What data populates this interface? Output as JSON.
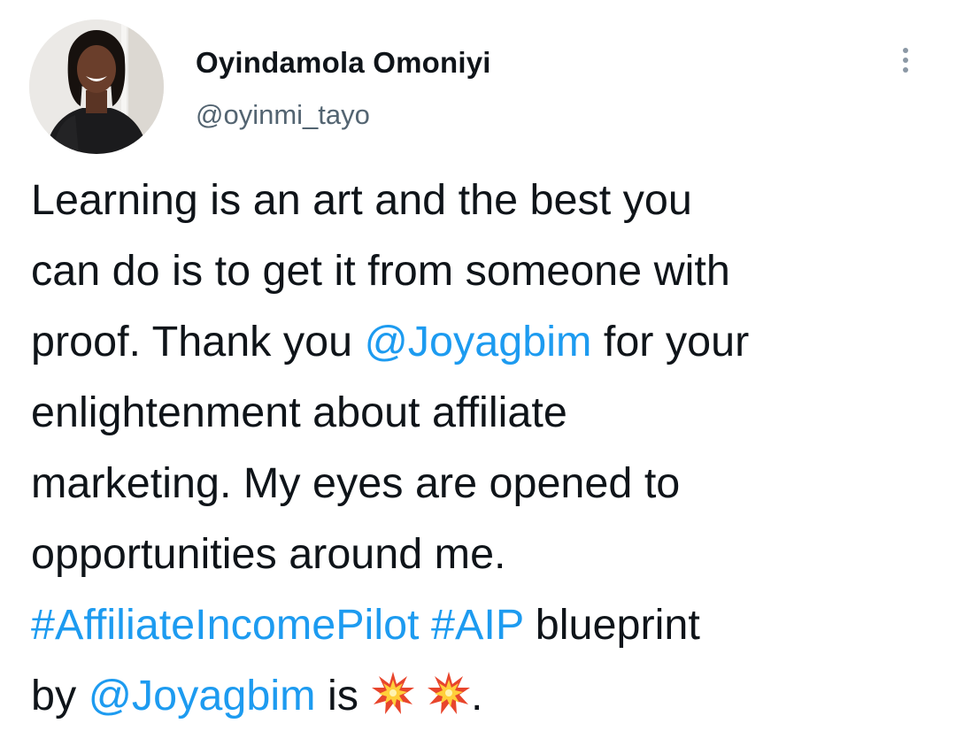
{
  "author": {
    "display_name": "Oyindamola Omoniyi",
    "handle": "@oyinmi_tayo"
  },
  "menu": {
    "icon": "more-vertical-icon"
  },
  "tweet": {
    "segments": {
      "s1": "Learning is an art and the best you",
      "s2": "can do is to get it from someone with",
      "s3": "proof. Thank you ",
      "mention_1": "@Joyagbim",
      "s4": " for your",
      "s5": "enlightenment about affiliate",
      "s6": "marketing. My eyes are opened to",
      "s7": "opportunities around me.",
      "hashtag_1": "#AffiliateIncomePilot",
      "s8": " ",
      "hashtag_2": "#AIP",
      "s9": " blueprint",
      "s10": "by ",
      "mention_2": "@Joyagbim",
      "s11": " is ",
      "s12": " ",
      "s13": "."
    },
    "emoji": [
      "collision-icon",
      "collision-icon"
    ]
  },
  "colors": {
    "link": "#1d9bf0",
    "handle": "#536471",
    "text": "#0f1419"
  }
}
